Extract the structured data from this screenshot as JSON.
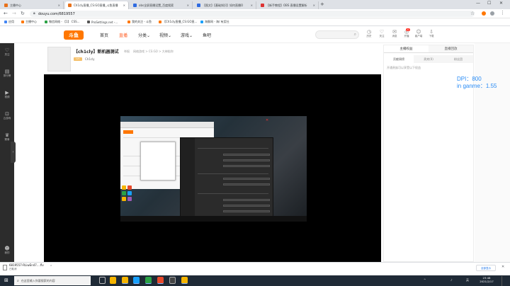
{
  "browser": {
    "tabs": [
      {
        "title": "主播中心",
        "active": false
      },
      {
        "title": "Ch1cly直播_CS:GO直播_斗鱼直播",
        "active": true
      },
      {
        "title": "obs全屏直播设置_百度搜索",
        "active": false
      },
      {
        "title": "【图文】【基础知识】如何直播O",
        "active": false
      },
      {
        "title": "【新手教程】OBS 直播设置解析",
        "active": false
      }
    ],
    "new_tab": "+",
    "window_controls": [
      "—",
      "☐",
      "✕"
    ],
    "url": "douyu.com/6819557",
    "bookmarks": [
      "应用",
      "主播中心",
      "微信网络 - 【1】 CSS...",
      "ProSettings.net -...",
      "我的关注 - 斗鱼",
      "【Ch1cly直播_CS:GO直...",
      "海豚网 - 海/ 有奖社"
    ]
  },
  "site": {
    "logo": "斗鱼",
    "nav": [
      {
        "label": "首页",
        "active": false
      },
      {
        "label": "直播",
        "active": true
      },
      {
        "label": "分类",
        "active": false,
        "arrow": true
      },
      {
        "label": "视频",
        "active": false,
        "arrow": true
      },
      {
        "label": "游戏",
        "active": false,
        "arrow": true
      },
      {
        "label": "鱼吧",
        "active": false
      }
    ],
    "header_icons": [
      {
        "icon": "clock-icon",
        "glyph": "◷",
        "label": "历史"
      },
      {
        "icon": "heart-icon",
        "glyph": "♡",
        "label": "关注"
      },
      {
        "icon": "envelope-icon",
        "glyph": "✉",
        "label": "消息"
      },
      {
        "icon": "broadcast-icon",
        "glyph": "◎",
        "label": "开播"
      },
      {
        "icon": "user-icon",
        "glyph": "☺",
        "label": "客户端"
      },
      {
        "icon": "download-icon",
        "glyph": "⇩",
        "label": "下载"
      }
    ],
    "badge_count": "1"
  },
  "sidebar": {
    "items": [
      {
        "icon": "heart-icon",
        "glyph": "♡",
        "label": "关注"
      },
      {
        "icon": "rank-icon",
        "glyph": "▤",
        "label": "排行榜"
      },
      {
        "icon": "video-icon",
        "glyph": "▶",
        "label": "视频"
      },
      {
        "icon": "gamepad-icon",
        "glyph": "⊡",
        "label": "云游戏"
      },
      {
        "icon": "trophy-icon",
        "glyph": "♛",
        "label": "赛事"
      }
    ],
    "bottom": {
      "icon": "user-icon",
      "glyph": "☻",
      "label": "我的"
    },
    "collapse_glyph": "›"
  },
  "room": {
    "title": "【ch1cly】新机器测试",
    "tags": [
      "举报",
      "网络游戏 > CS:GO > 大神陪你"
    ],
    "level": "LV1",
    "anchor": "Ch1cly"
  },
  "right_panel": {
    "tabs": [
      {
        "label": "主播权益",
        "active": true
      },
      {
        "label": "直播回放",
        "active": false
      }
    ],
    "subtabs": [
      {
        "label": "贡献周榜",
        "active": true
      },
      {
        "label": "贵宾(0)",
        "active": false
      },
      {
        "label": "粉丝团",
        "active": false
      }
    ],
    "note": "开通贵族可以享受以下权益",
    "overlay_lines": [
      "DPI：800",
      "in ganme：1.55"
    ]
  },
  "downloads": {
    "file_name": "6819557-RLiwEn47....flv",
    "status": "已取消",
    "arrow": "⌃",
    "show_all": "全部显示",
    "close": "✕"
  },
  "taskbar": {
    "search_placeholder": "在这里输入你要搜索的内容",
    "apps": [
      "#f5b400",
      "#18a0fb",
      "#2ba245",
      "#e84a2b",
      "#333",
      "#f5b400"
    ],
    "time": "23:48",
    "date": "2021/2/17",
    "tray": [
      "^",
      "♪",
      "英"
    ]
  }
}
